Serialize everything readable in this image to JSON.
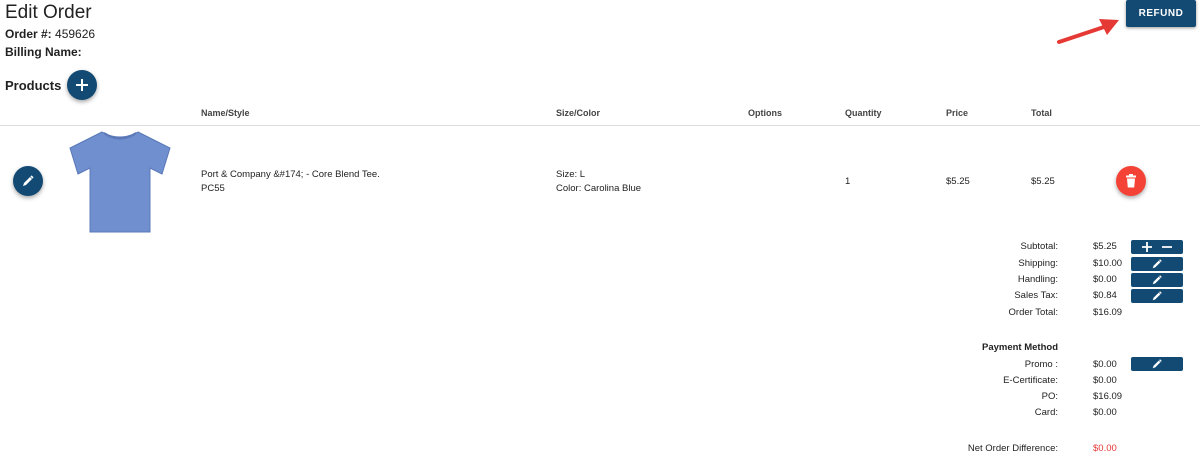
{
  "header": {
    "title": "Edit Order",
    "order_label": "Order #:",
    "order_number": "459626",
    "billing_label": "Billing Name:",
    "billing_name": "",
    "refund_label": "REFUND"
  },
  "products": {
    "label": "Products",
    "columns": [
      "Name/Style",
      "Size/Color",
      "Options",
      "Quantity",
      "Price",
      "Total"
    ],
    "items": [
      {
        "name": "Port & Company &#174; - Core Blend Tee.",
        "style": "PC55",
        "size": "Size: L",
        "color": "Color: Carolina Blue",
        "options": "",
        "quantity": "1",
        "price": "$5.25",
        "total": "$5.25",
        "shirt_color": "#6f8fcf"
      }
    ]
  },
  "summary": {
    "subtotal_label": "Subtotal:",
    "subtotal": "$5.25",
    "shipping_label": "Shipping:",
    "shipping": "$10.00",
    "handling_label": "Handling:",
    "handling": "$0.00",
    "tax_label": "Sales Tax:",
    "tax": "$0.84",
    "order_total_label": "Order Total:",
    "order_total": "$16.09"
  },
  "payment": {
    "title": "Payment Method",
    "promo_label": "Promo :",
    "promo": "$0.00",
    "ecert_label": "E-Certificate:",
    "ecert": "$0.00",
    "po_label": "PO:",
    "po": "$16.09",
    "card_label": "Card:",
    "card": "$0.00",
    "net_diff_label": "Net Order Difference:",
    "net_diff": "$0.00"
  },
  "colors": {
    "primary": "#134a73",
    "danger": "#f44336",
    "negative_text": "#e53935",
    "annotation_arrow": "#e53935"
  }
}
